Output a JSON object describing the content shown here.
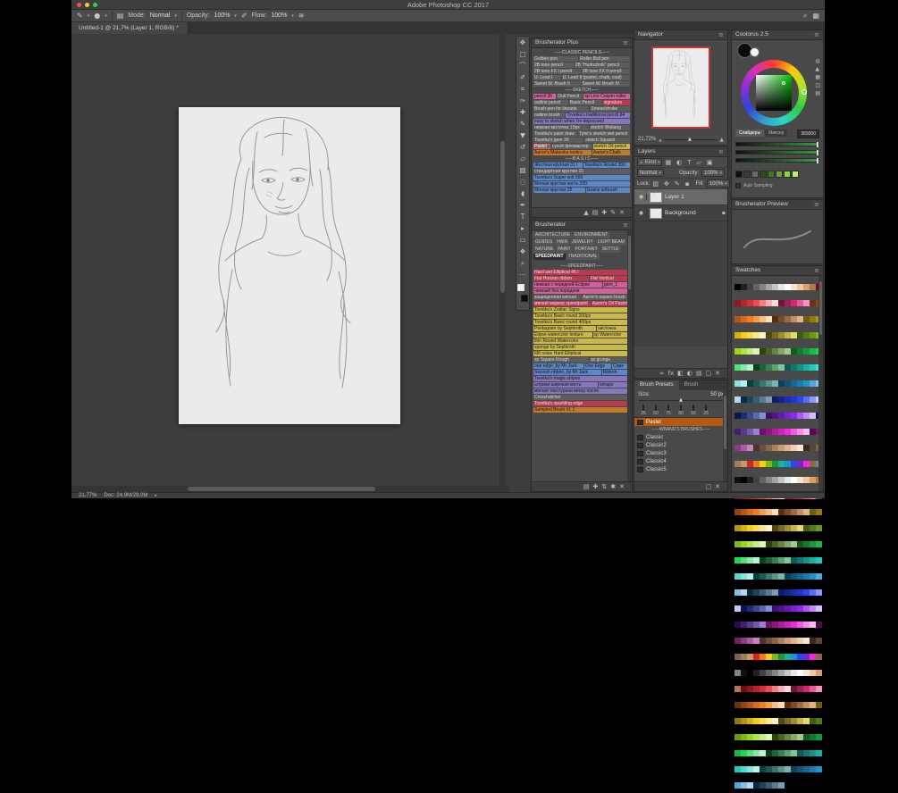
{
  "titlebar": {
    "title": "Adobe Photoshop CC 2017"
  },
  "tabbar": {
    "doc_tab": "Untitled-1 @ 21,7% (Layer 1, RGB/8) *"
  },
  "options": {
    "mode_label": "Mode:",
    "mode_value": "Normal",
    "opacity_label": "Opacity:",
    "opacity_value": "100%",
    "flow_label": "Flow:",
    "flow_value": "100%"
  },
  "tools": [
    {
      "name": "move-tool",
      "glyph": "✥"
    },
    {
      "name": "marquee-tool",
      "glyph": "▢"
    },
    {
      "name": "lasso-tool",
      "glyph": "⌒"
    },
    {
      "name": "quick-selection-tool",
      "glyph": "✐"
    },
    {
      "name": "crop-tool",
      "glyph": "⌗"
    },
    {
      "name": "eyedropper-tool",
      "glyph": "✑"
    },
    {
      "name": "healing-brush-tool",
      "glyph": "✚"
    },
    {
      "name": "brush-tool",
      "glyph": "✎"
    },
    {
      "name": "clone-stamp-tool",
      "glyph": "▼"
    },
    {
      "name": "history-brush-tool",
      "glyph": "↺"
    },
    {
      "name": "eraser-tool",
      "glyph": "▱"
    },
    {
      "name": "gradient-tool",
      "glyph": "▨"
    },
    {
      "name": "blur-tool",
      "glyph": "◌"
    },
    {
      "name": "dodge-tool",
      "glyph": "◖"
    },
    {
      "name": "pen-tool",
      "glyph": "✒"
    },
    {
      "name": "type-tool",
      "glyph": "T"
    },
    {
      "name": "path-selection-tool",
      "glyph": "▸"
    },
    {
      "name": "shape-tool",
      "glyph": "▭"
    },
    {
      "name": "hand-tool",
      "glyph": "❖"
    },
    {
      "name": "zoom-tool",
      "glyph": "⌕"
    },
    {
      "name": "edit-toolbar-icon",
      "glyph": "⋯"
    }
  ],
  "toolbar_colors": {
    "foreground": "#f2f2f2",
    "background": "#0d0d0d"
  },
  "bplus": {
    "title": "Brusherator Plus",
    "rows": [
      {
        "header": "-----CLASSIC PENCILS-----"
      },
      {
        "items": [
          {
            "t": "Golden pen",
            "c": "gray"
          },
          {
            "t": "Roller Ball pen",
            "c": "gray"
          }
        ]
      },
      {
        "items": [
          {
            "t": "2B tone pencil",
            "c": "gray"
          },
          {
            "t": "2B \"Hudozhnik\" pencil",
            "c": "gray"
          }
        ]
      },
      {
        "items": [
          {
            "t": "2B tone FX I pencil",
            "c": "gray"
          },
          {
            "t": "2B tone FX II pencil",
            "c": "gray"
          }
        ]
      },
      {
        "items": [
          {
            "t": "U. Lead I",
            "c": "gray"
          },
          {
            "t": "U. Lead II (pastel, chalk, coal)",
            "c": "gray"
          }
        ]
      },
      {
        "items": [
          {
            "t": "Sweet W. Brush II",
            "c": "gray"
          },
          {
            "t": "Sweet W. Brush IV",
            "c": "gray"
          }
        ]
      },
      {
        "header": "-----SKETCH-----"
      },
      {
        "items": [
          {
            "t": "pencil 2b",
            "c": "pink"
          },
          {
            "t": "Dull Pencil",
            "c": "gray"
          },
          {
            "t": "sp Lino Crayon roller",
            "c": "pink"
          }
        ]
      },
      {
        "items": [
          {
            "t": "outline pencil",
            "c": "gray"
          },
          {
            "t": "Basic Pencil",
            "c": "gray"
          },
          {
            "t": "signature",
            "c": "red"
          }
        ]
      },
      {
        "items": [
          {
            "t": "Brush pen for linearts",
            "c": "gray"
          },
          {
            "t": "Smear/stroke",
            "c": "gray"
          }
        ]
      },
      {
        "items": [
          {
            "t": "outline brush",
            "c": "gray"
          },
          {
            "t": "Tsvetka's traditional pencil 84",
            "c": "purple"
          }
        ]
      },
      {
        "items": [
          {
            "t": "easy to sketch when I'm depressed",
            "c": "purple"
          }
        ]
      },
      {
        "items": [
          {
            "t": "нежная кисточка 10px",
            "c": "gray"
          },
          {
            "t": "sketch Weitang",
            "c": "gray"
          }
        ]
      },
      {
        "items": [
          {
            "t": "Tsvetka's paint draw",
            "c": "gray"
          },
          {
            "t": "Tyler's sketch wet pencil",
            "c": "gray"
          }
        ]
      },
      {
        "items": [
          {
            "t": "Tsvetka's gem 30",
            "c": "gray"
          },
          {
            "t": "sketch Squarol",
            "c": "gray"
          }
        ]
      },
      {
        "items": [
          {
            "t": "Pastel",
            "c": "selected"
          },
          {
            "t": "сухой фломастер",
            "c": "gray"
          },
          {
            "t": "sketch Oil pencil",
            "c": "yellow"
          }
        ]
      },
      {
        "items": [
          {
            "t": "Aaron's Malarska mokra",
            "c": "orange"
          },
          {
            "t": "Aaron's Chalk",
            "c": "orange"
          }
        ]
      },
      {
        "header": "-----B A S I C-----"
      },
      {
        "items": [
          {
            "t": "Жесткая круглая 31 I",
            "c": "blue"
          },
          {
            "t": "Tsvetka's Round 300",
            "c": "blue"
          }
        ]
      },
      {
        "items": [
          {
            "t": "стандартная круглая 15",
            "c": "gray"
          }
        ]
      },
      {
        "items": [
          {
            "t": "Tsvetka's Super soft 500",
            "c": "blue"
          }
        ]
      },
      {
        "items": [
          {
            "t": "Мягкая круглая кисть 200",
            "c": "blue"
          }
        ]
      },
      {
        "items": [
          {
            "t": "Мягкая круглая 25",
            "c": "blue"
          },
          {
            "t": "Grainy airbrush",
            "c": "blue"
          }
        ]
      }
    ],
    "footer_icons": [
      {
        "name": "sort-icon",
        "glyph": "▲"
      },
      {
        "name": "folder-icon",
        "glyph": "▤"
      },
      {
        "name": "add-brush-icon",
        "glyph": "✚"
      },
      {
        "name": "edit-brush-icon",
        "glyph": "✎"
      },
      {
        "name": "delete-brush-icon",
        "glyph": "✕"
      }
    ]
  },
  "brusherator": {
    "title": "Brusherator",
    "categories": [
      "ARCHITECTURE",
      "ENVIRONMENT",
      "GUIDES",
      "HAIR",
      "JEWELRY",
      "LIGHT BEAM",
      "NATURE",
      "PAINT",
      "PORTRAIT",
      "SETTLE",
      "SPEEDPAINT",
      "TRADITIONAL"
    ],
    "active_category": "SPEEDPAINT",
    "rows": [
      {
        "header": "-----SPEEDPAINT-----"
      },
      {
        "items": [
          {
            "t": "Hard wet Elliptical 45 I",
            "c": "red"
          }
        ]
      },
      {
        "items": [
          {
            "t": "Flat Horizon ribbon",
            "c": "red"
          },
          {
            "t": "Flat Vertical",
            "c": "red"
          }
        ]
      },
      {
        "items": [
          {
            "t": "нежная с передней Eclipse",
            "c": "pink"
          },
          {
            "t": "gem_1",
            "c": "pink"
          }
        ]
      },
      {
        "items": [
          {
            "t": "нежный без передачи",
            "c": "pink"
          }
        ]
      },
      {
        "items": [
          {
            "t": "защищенная мягкая",
            "c": "gray"
          },
          {
            "t": "Aaron's square brush",
            "c": "gray"
          }
        ]
      },
      {
        "items": [
          {
            "t": "мягкий маркер speedpaint",
            "c": "red"
          },
          {
            "t": "Aaron's Oil Pastel",
            "c": "red"
          }
        ]
      },
      {
        "items": [
          {
            "t": "Tsvetka's Zodiac Signs",
            "c": "yellow"
          }
        ]
      },
      {
        "items": [
          {
            "t": "Tsvetka's Basic round 200px",
            "c": "yellow"
          }
        ]
      },
      {
        "items": [
          {
            "t": "Tsvetka's Basic round 400px",
            "c": "yellow"
          }
        ]
      },
      {
        "items": [
          {
            "t": "Pentagram by Sephiroth",
            "c": "yellow"
          },
          {
            "t": "кисточка",
            "c": "yellow"
          }
        ]
      },
      {
        "items": [
          {
            "t": "Elipse watercolor texture",
            "c": "yellow"
          },
          {
            "t": "sp Watercolor",
            "c": "yellow"
          }
        ]
      },
      {
        "items": [
          {
            "t": "thin Round Watercolor",
            "c": "yellow"
          }
        ]
      },
      {
        "items": [
          {
            "t": "sponge by Sephiroth",
            "c": "yellow"
          }
        ]
      },
      {
        "items": [
          {
            "t": "M8 noise Hard Elliptical",
            "c": "yellow"
          }
        ]
      },
      {
        "items": [
          {
            "t": "sp Square Rough",
            "c": "gray"
          },
          {
            "t": "sp grunge",
            "c": "gray"
          }
        ]
      },
      {
        "items": [
          {
            "t": "one edge_by Mr Jack",
            "c": "blue"
          },
          {
            "t": "One Edge",
            "c": "blue"
          },
          {
            "t": "Cape",
            "c": "blue"
          }
        ]
      },
      {
        "items": [
          {
            "t": "Swoosh ribbon_by Mr Jack",
            "c": "blue"
          },
          {
            "t": "Ribbon",
            "c": "blue"
          }
        ]
      },
      {
        "items": [
          {
            "t": "Tsvetka's magic stripes",
            "c": "purple"
          }
        ]
      },
      {
        "items": [
          {
            "t": "штрихи широкая кисть",
            "c": "purple"
          },
          {
            "t": "letraps",
            "c": "purple"
          }
        ]
      },
      {
        "items": [
          {
            "t": "мягкая текстурная ветер после",
            "c": "purple"
          }
        ]
      },
      {
        "items": [
          {
            "t": "Crosshatcher",
            "c": "gray"
          }
        ]
      },
      {
        "items": [
          {
            "t": "Tsvetka's sparkling edge",
            "c": "red"
          }
        ]
      },
      {
        "items": [
          {
            "t": "Sampled Brush #1 1",
            "c": "orange"
          }
        ]
      }
    ],
    "footer_icons": [
      {
        "name": "folder-icon",
        "glyph": "▤"
      },
      {
        "name": "add-icon",
        "glyph": "✚"
      },
      {
        "name": "sync-icon",
        "glyph": "⇅"
      },
      {
        "name": "settings-icon",
        "glyph": "✱"
      },
      {
        "name": "delete-icon",
        "glyph": "✕"
      }
    ]
  },
  "navigator": {
    "title": "Navigator",
    "zoom": "21,72%"
  },
  "layers": {
    "title": "Layers",
    "kind_label": "Kind",
    "blend_mode": "Normal",
    "opacity_label": "Opacity:",
    "opacity_value": "100%",
    "lock_label": "Lock:",
    "fill_label": "Fill:",
    "fill_value": "100%",
    "filter_icons": [
      {
        "name": "filter-pixel-icon",
        "glyph": "▦"
      },
      {
        "name": "filter-adjustment-icon",
        "glyph": "◐"
      },
      {
        "name": "filter-type-icon",
        "glyph": "T"
      },
      {
        "name": "filter-shape-icon",
        "glyph": "▱"
      },
      {
        "name": "filter-smart-object-icon",
        "glyph": "▣"
      }
    ],
    "lock_icons": [
      {
        "name": "lock-transparency-icon",
        "glyph": "▨"
      },
      {
        "name": "lock-position-icon",
        "glyph": "✥"
      },
      {
        "name": "lock-pixels-icon",
        "glyph": "✎"
      },
      {
        "name": "lock-all-icon",
        "glyph": "▪"
      }
    ],
    "items": [
      {
        "name": "Layer 1",
        "selected": true,
        "locked": false
      },
      {
        "name": "Background",
        "selected": false,
        "locked": true
      }
    ],
    "bottom_icons": [
      {
        "name": "link-layers-icon",
        "glyph": "∞"
      },
      {
        "name": "layer-style-icon",
        "glyph": "fx"
      },
      {
        "name": "layer-mask-icon",
        "glyph": "◧"
      },
      {
        "name": "adjustment-layer-icon",
        "glyph": "◐"
      },
      {
        "name": "layer-group-icon",
        "glyph": "▤"
      },
      {
        "name": "new-layer-icon",
        "glyph": "▢"
      },
      {
        "name": "delete-layer-icon",
        "glyph": "✕"
      }
    ]
  },
  "presets": {
    "tabs": [
      "Brush Presets",
      "Brush"
    ],
    "active_tab": "Brush Presets",
    "size_label": "Size:",
    "size_value": "50 px",
    "tips": [
      "25",
      "50",
      "75",
      "80",
      "50",
      "25"
    ],
    "items": [
      {
        "label": "Pastel",
        "selected": true
      },
      {
        "divider": "-----WBAND'S BRUSHES-----"
      },
      {
        "label": "Classic"
      },
      {
        "label": "Classic2"
      },
      {
        "label": "Classic3"
      },
      {
        "label": "Classic4"
      },
      {
        "label": "Classic5"
      }
    ],
    "footer_icons": [
      {
        "name": "new-preset-icon",
        "glyph": "▢"
      },
      {
        "name": "delete-preset-icon",
        "glyph": "✕"
      }
    ]
  },
  "coolorus": {
    "title": "Coolorus 2.5",
    "tabs": [
      "Слайдеры",
      "Миксер"
    ],
    "active_tab": "Слайдеры",
    "hex": "383000",
    "auto_label": "Auto Sampling",
    "recent_colors": [
      "#101010",
      "#3a3a3a",
      "#6a6a6a",
      "#274e13",
      "#3f7a1e",
      "#66a82e",
      "#8fd23e",
      "#c2ee5e"
    ],
    "side_icons": [
      {
        "name": "wheel-mode-icon",
        "glyph": "◍"
      },
      {
        "name": "triangle-mode-icon",
        "glyph": "▲"
      },
      {
        "name": "square-mode-icon",
        "glyph": "▦"
      },
      {
        "name": "gamut-lock-icon",
        "glyph": "◫"
      },
      {
        "name": "options-icon",
        "glyph": "▤"
      }
    ]
  },
  "preview": {
    "title": "Brusherator Preview"
  },
  "swatches": {
    "title": "Swatches",
    "columns": 13,
    "colors": [
      "#000000",
      "#212121",
      "#424242",
      "#636363",
      "#848484",
      "#a5a5a5",
      "#c6c6c6",
      "#e7e7e7",
      "#ffffff",
      "#f7e7ce",
      "#edc9a3",
      "#d9a066",
      "#b5784a",
      "#6b0f14",
      "#8f1a1f",
      "#b3242b",
      "#d72f38",
      "#f04a52",
      "#f47c82",
      "#f8aeb2",
      "#fbd8da",
      "#70143c",
      "#a21d57",
      "#d02873",
      "#ee5596",
      "#f592c0",
      "#6e3410",
      "#8f4512",
      "#b35716",
      "#d96a1a",
      "#f07e20",
      "#f59d4e",
      "#f9bd82",
      "#fcdebf",
      "#5c2e0e",
      "#7d4a24",
      "#a06a3e",
      "#c48f5e",
      "#e0b484",
      "#6e5d10",
      "#90790f",
      "#b2960e",
      "#d4b30d",
      "#f6d00c",
      "#f8dc4a",
      "#fae788",
      "#fcf2c5",
      "#55480e",
      "#7a6a1c",
      "#a08e2e",
      "#c6b448",
      "#e8d96e",
      "#3f5c10",
      "#547a12",
      "#6a9914",
      "#80b816",
      "#96d718",
      "#aee24e",
      "#c6ec84",
      "#dff5bb",
      "#2e430c",
      "#4a6420",
      "#668541",
      "#84a666",
      "#a6c98e",
      "#0e5c22",
      "#127a2e",
      "#16993a",
      "#1ab846",
      "#1ed752",
      "#52e07c",
      "#86e9a6",
      "#bbf2d0",
      "#0a4218",
      "#1f6132",
      "#3a8150",
      "#5ca270",
      "#84c496",
      "#0c5c54",
      "#10786e",
      "#149488",
      "#18b0a2",
      "#1cccbc",
      "#50d9cc",
      "#84e5dc",
      "#b9f1ec",
      "#083f3a",
      "#1a5c55",
      "#36796f",
      "#58968a",
      "#80b3a8",
      "#0c3f5c",
      "#105478",
      "#146994",
      "#187eb0",
      "#1c93cc",
      "#50a9d9",
      "#84bfe5",
      "#b9d6f1",
      "#082c3f",
      "#1a455c",
      "#366079",
      "#587c96",
      "#809ab3",
      "#101c6e",
      "#16248f",
      "#1c2cb0",
      "#2234d1",
      "#2848f2",
      "#5a6ef5",
      "#8c97f8",
      "#becbfb",
      "#0c1452",
      "#202a70",
      "#3a478f",
      "#5a68ae",
      "#8290cd",
      "#3c106e",
      "#51168f",
      "#661cb0",
      "#7b22d1",
      "#9028f2",
      "#a85af5",
      "#c08cf8",
      "#d8befb",
      "#2a0c52",
      "#3f2070",
      "#593a8f",
      "#7658ae",
      "#9880cd",
      "#6e1064",
      "#8f1682",
      "#b01ca0",
      "#d122be",
      "#f228dc",
      "#f55ae4",
      "#f88cec",
      "#fbbef4",
      "#520c4a",
      "#702066",
      "#8f3a84",
      "#ae58a4",
      "#cd80c4",
      "#4a3626",
      "#6b4f38",
      "#8c684a",
      "#ad815c",
      "#ce9a6e",
      "#e2b48e",
      "#f0cfae",
      "#f9e9d4",
      "#3a2a1e",
      "#5c4632",
      "#7e6246",
      "#a07e5a",
      "#c29a6e",
      "#e02020",
      "#f07820",
      "#f6d00c",
      "#80b816",
      "#16993a",
      "#18b0a2",
      "#1c93cc",
      "#2848f2",
      "#7b22d1",
      "#f228dc",
      "#8c684a",
      "#848484",
      "#101010"
    ]
  },
  "status": {
    "zoom": "21,77%",
    "doc": "Doc: 24,9M/29,0M"
  }
}
